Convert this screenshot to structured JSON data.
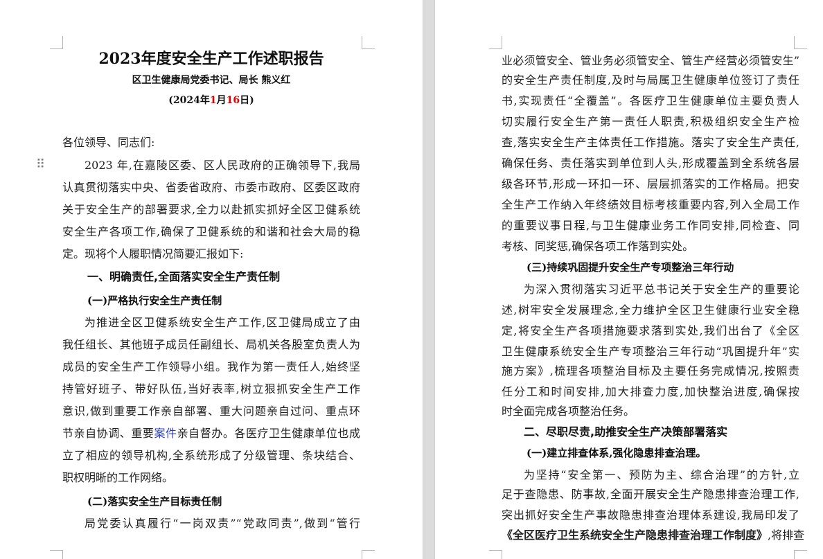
{
  "document": {
    "title": "2023年度安全生产工作述职报告",
    "author": "区卫生健康局党委书记、局长   熊义红",
    "date": {
      "open": "(2024年",
      "month": "1",
      "month_label": "月",
      "day": "16",
      "close": "日)"
    }
  },
  "left_page": {
    "salutation": "各位领导、同志们:",
    "para1": [
      "2023 年,在嘉陵区委、区人民政府的正确领导下,我局",
      "认真贯彻落实中央、省委省政府、市委市政府、区委区政府",
      "关于安全生产的部署要求,全力以赴抓实抓好全区卫健系统",
      "安全生产各项工作,确保了卫健系统的和谐和社会大局的稳",
      "定。现将个人履职情况简要汇报如下:"
    ],
    "heading1": "一、明确责任,全面落实安全生产责任制",
    "heading1_1": "(一)严格执行安全生产责任制",
    "para2": [
      "为推进全区卫健系统安全生产工作,区卫健局成立了由",
      "我任组长、其他班子成员任副组长、局机关各股室负责人为",
      "成员的安全生产工作领导小组。我作为第一责任人,始终坚",
      "持管好班子、带好队伍,当好表率,树立狠抓安全生产工作",
      "意识,做到重要工作亲自部署、重大问题亲自过问、重点环"
    ],
    "para2_line6": {
      "before": "节亲自协调、重要",
      "link": "案件",
      "after": "亲自督办。各医疗卫生健康单位也成"
    },
    "para2_rest": [
      "立了相应的领导机构,全系统形成了分级管理、条块结合、",
      "职权明晰的工作网络。"
    ],
    "heading1_2": "(二)落实安全生产目标责任制",
    "para3_first": "局党委认真履行“一岗双责”“党政同责”,做到“管行"
  },
  "right_page": {
    "para3_cont": [
      "业必须管安全、管业务必须管安全、管生产经营必须管安生”",
      "的安全生产责任制度,及时与局属卫生健康单位签订了责任",
      "书,实现责任“全覆盖”。各医疗卫生健康单位主要负责人",
      "切实履行安全生产第一责任人职责,积极组织安全生产检",
      "查,落实安全生产主体责任工作措施。落实了安全生产责任,",
      "确保任务、责任落实到单位到人头,形成覆盖到全系统各层",
      "级各环节,形成一环扣一环、层层抓落实的工作格局。把安",
      "全生产工作纳入年终绩效目标考核重要内容,列入全局工作",
      "的重要议事日程,与卫生健康业务工作同安排,同检查、同",
      "考核、同奖惩,确保各项工作落到实处。"
    ],
    "heading1_3": "(三)持续巩固提升安全生产专项整治三年行动",
    "para4": [
      "为深入贯彻落实习近平总书记关于安全生产的重要论",
      "述,树牢安全发展理念,全力维护全区卫生健康行业安全稳",
      "定,将安全生产各项措施要求落到实处,我们出台了《全区",
      "卫生健康系统安全生产专项整治三年行动“巩固提升年”实",
      "施方案》,梳理各项整治目标及主要任务完成情况,按照责",
      "任分工和时间安排,加大排查力度,加快整治进度,确保按",
      "时全面完成各项整治任务。"
    ],
    "heading2": "二、尽职尽责,助推安全生产决策部署落实",
    "heading2_1": "(一)建立排查体系,强化隐患排查治理。",
    "para5": [
      "为坚持“安全第一、预防为主、综合治理”的方针,立",
      "足于查隐患、防事故,全面开展安全生产隐患排查治理工作,",
      "突出抓好安全生产事故隐患排查治理体系建设,我局印发了"
    ],
    "para5_last": {
      "bold": "《全区医疗卫生系统安全生产隐患排查治理工作制度》",
      "after": ",将排查"
    }
  },
  "ui": {
    "drag_handle": "⠿"
  }
}
